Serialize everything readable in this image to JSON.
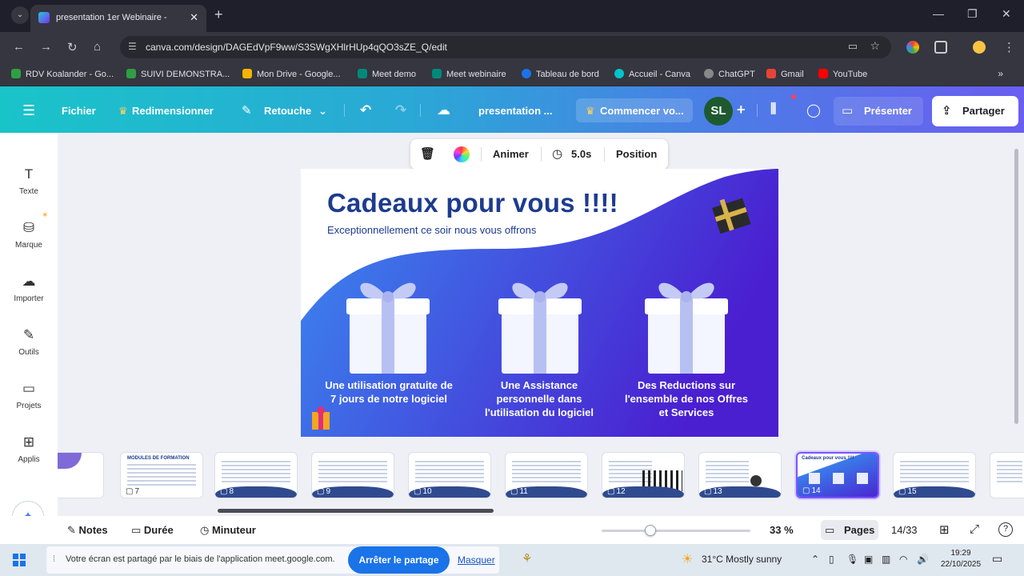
{
  "browser": {
    "tab_title": "presentation 1er Webinaire - ",
    "url": "canva.com/design/DAGEdVpF9ww/S3SWgXHlrHUp4qQO3sZE_Q/edit",
    "bookmarks": [
      {
        "label": "RDV Koalander - Go...",
        "color": "#2f9e44"
      },
      {
        "label": "SUIVI DEMONSTRA...",
        "color": "#2f9e44"
      },
      {
        "label": "Mon Drive - Google...",
        "color": "#f4b400"
      },
      {
        "label": "Meet demo",
        "color": "#00897b"
      },
      {
        "label": "Meet webinaire",
        "color": "#00897b"
      },
      {
        "label": "Tableau de bord",
        "color": "#1a73e8"
      },
      {
        "label": "Accueil - Canva",
        "color": "#00c4cc"
      },
      {
        "label": "ChatGPT",
        "color": "#888888"
      },
      {
        "label": "Gmail",
        "color": "#ea4335"
      },
      {
        "label": "YouTube",
        "color": "#ff0000"
      }
    ]
  },
  "header": {
    "file": "Fichier",
    "resize": "Redimensionner",
    "edit": "Retouche",
    "title": "presentation ...",
    "start": "Commencer vo...",
    "avatar": "SL",
    "present": "Présenter",
    "share": "Partager"
  },
  "sidebar": {
    "items": [
      {
        "label": "Texte",
        "icon": "text-icon"
      },
      {
        "label": "Marque",
        "icon": "brand-icon"
      },
      {
        "label": "Importer",
        "icon": "upload-icon"
      },
      {
        "label": "Outils",
        "icon": "tools-icon"
      },
      {
        "label": "Projets",
        "icon": "folder-icon"
      },
      {
        "label": "Applis",
        "icon": "apps-icon"
      }
    ]
  },
  "context_toolbar": {
    "animate": "Animer",
    "duration": "5.0s",
    "position": "Position"
  },
  "slide": {
    "title": "Cadeaux pour vous !!!!",
    "subtitle": "Exceptionnellement ce soir nous vous offrons",
    "gifts": [
      "Une utilisation gratuite de 7 jours de notre logiciel",
      "Une Assistance personnelle dans l'utilisation du logiciel",
      "Des Reductions sur l'ensemble de nos Offres et Services"
    ],
    "colors": {
      "title": "#1d3b8f",
      "band_start": "#3a7bea",
      "band_end": "#4a1fd0"
    }
  },
  "filmstrip": {
    "thumbs": [
      {
        "num": "",
        "partial": true
      },
      {
        "num": "7",
        "heading": "MODULES DE FORMATION"
      },
      {
        "num": "8"
      },
      {
        "num": "9"
      },
      {
        "num": "10"
      },
      {
        "num": "11"
      },
      {
        "num": "12"
      },
      {
        "num": "13"
      },
      {
        "num": "14",
        "active": true,
        "heading": "Cadeaux pour vous !!!!"
      },
      {
        "num": "15"
      }
    ]
  },
  "bottom": {
    "notes": "Notes",
    "duration": "Durée",
    "timer": "Minuteur",
    "zoom": "33 %",
    "zoom_fraction": 0.33,
    "pages": "Pages",
    "page_count": "14/33",
    "help": "?"
  },
  "taskbar": {
    "share_text": "Votre écran est partagé par le biais de l'application meet.google.com.",
    "stop_share": "Arrêter le partage",
    "hide": "Masquer",
    "weather": "31°C  Mostly sunny",
    "time": "19:29",
    "date": "22/10/2025"
  }
}
